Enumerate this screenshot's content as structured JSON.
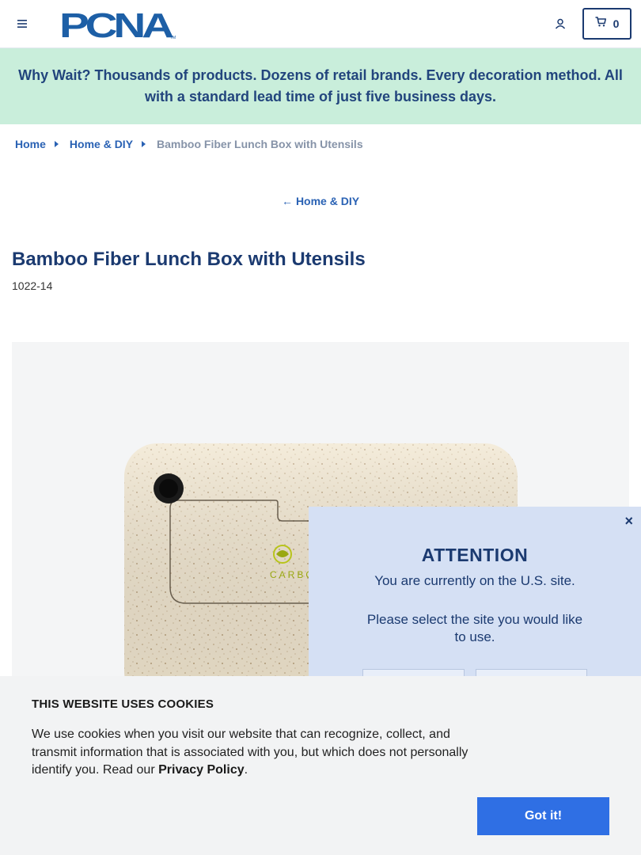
{
  "header": {
    "logo_text": "PCNA",
    "logo_tm": "TM",
    "cart_count": "0",
    "brand_color": "#1b3a70"
  },
  "icons": {
    "menu": "hamburger-icon",
    "account": "user-icon",
    "cart": "cart-icon",
    "back": "arrow-left-icon",
    "close": "close-icon"
  },
  "promo": {
    "text": "Why Wait? Thousands of products. Dozens of retail brands. Every decoration method. All with a standard lead time of just five business days.",
    "background": "#c9eedb"
  },
  "breadcrumb": {
    "home": "Home",
    "category": "Home & DIY",
    "current": "Bamboo Fiber Lunch Box with Utensils"
  },
  "back_link": {
    "arrow": "←",
    "label": "Home & DIY"
  },
  "product": {
    "title": "Bamboo Fiber Lunch Box with Utensils",
    "sku": "1022-14",
    "imprint_text": "CARBO"
  },
  "modal": {
    "close_glyph": "×",
    "title": "ATTENTION",
    "line1": "You are currently on the U.S. site.",
    "line2": "Please select the site you would like to use."
  },
  "cookie": {
    "title": "THIS WEBSITE USES COOKIES",
    "text_before": "We use cookies when you visit our website that can recognize, collect, and transmit information that is associated with you, but which does not personally identify you. Read our ",
    "link": "Privacy Policy",
    "text_after": ".",
    "button": "Got it!",
    "button_color": "#2f6fe4"
  }
}
